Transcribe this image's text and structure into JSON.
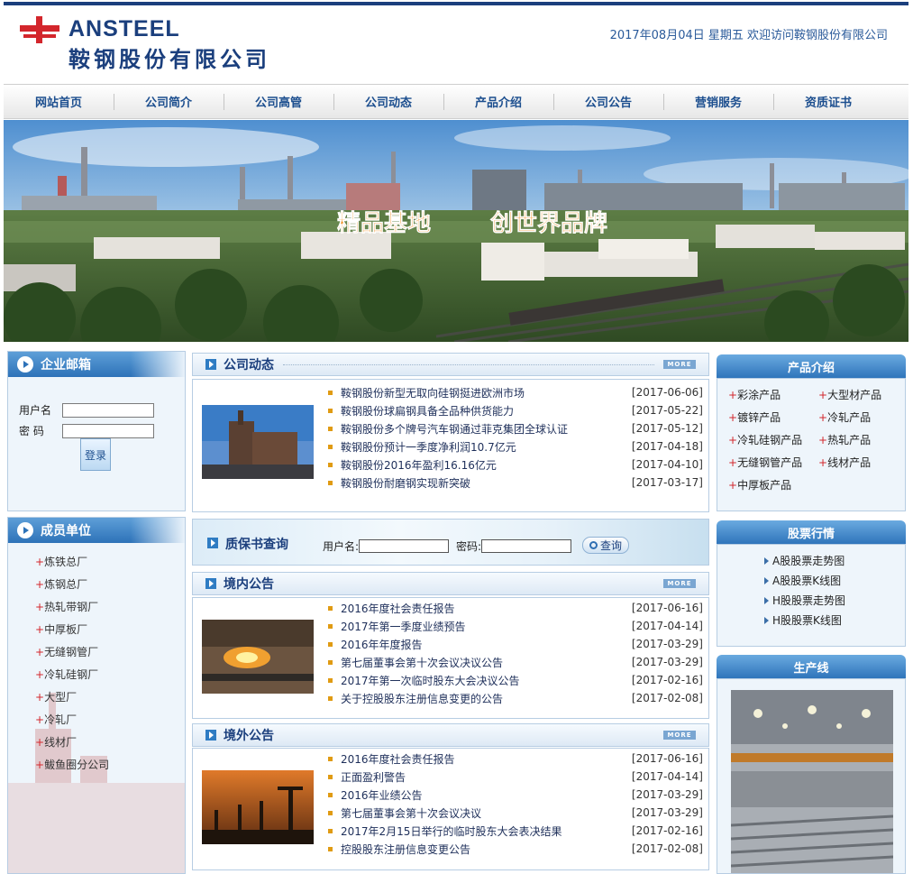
{
  "header": {
    "logo_en": "ANSTEEL",
    "logo_cn": "鞍钢股份有限公司",
    "date_text": "2017年08月04日 星期五 欢迎访问鞍钢股份有限公司",
    "brand_color": "#1b3f7d"
  },
  "nav": [
    "网站首页",
    "公司简介",
    "公司高管",
    "公司动态",
    "产品介绍",
    "公司公告",
    "营销服务",
    "资质证书"
  ],
  "banner": {
    "slogan_part1": "精品基地",
    "slogan_part2": "创世界品牌"
  },
  "mailbox": {
    "title": "企业邮箱",
    "user_label": "用户名",
    "pass_label": "密  码",
    "login_label": "登录"
  },
  "members": {
    "title": "成员单位",
    "items": [
      "炼铁总厂",
      "炼钢总厂",
      "热轧带钢厂",
      "中厚板厂",
      "无缝钢管厂",
      "冷轧硅钢厂",
      "大型厂",
      "冷轧厂",
      "线材厂",
      "鲅鱼圈分公司"
    ]
  },
  "company_news": {
    "title": "公司动态",
    "more": "MORE",
    "items": [
      {
        "title": "鞍钢股份新型无取向硅钢挺进欧洲市场",
        "date": "[2017-06-06]"
      },
      {
        "title": "鞍钢股份球扁钢具备全品种供货能力",
        "date": "[2017-05-22]"
      },
      {
        "title": "鞍钢股份多个牌号汽车钢通过菲克集团全球认证",
        "date": "[2017-05-12]"
      },
      {
        "title": "鞍钢股份预计一季度净利润10.7亿元",
        "date": "[2017-04-18]"
      },
      {
        "title": "鞍钢股份2016年盈利16.16亿元",
        "date": "[2017-04-10]"
      },
      {
        "title": "鞍钢股份耐磨钢实现新突破",
        "date": "[2017-03-17]"
      }
    ]
  },
  "warranty": {
    "title": "质保书查询",
    "user_label": "用户名:",
    "pass_label": "密码:",
    "query_label": "查询"
  },
  "domestic": {
    "title": "境内公告",
    "more": "MORE",
    "items": [
      {
        "title": "2016年度社会责任报告",
        "date": "[2017-06-16]"
      },
      {
        "title": "2017年第一季度业绩预告",
        "date": "[2017-04-14]"
      },
      {
        "title": "2016年年度报告",
        "date": "[2017-03-29]"
      },
      {
        "title": "第七届董事会第十次会议决议公告",
        "date": "[2017-03-29]"
      },
      {
        "title": "2017年第一次临时股东大会决议公告",
        "date": "[2017-02-16]"
      },
      {
        "title": "关于控股股东注册信息变更的公告",
        "date": "[2017-02-08]"
      }
    ]
  },
  "overseas": {
    "title": "境外公告",
    "more": "MORE",
    "items": [
      {
        "title": "2016年度社会责任报告",
        "date": "[2017-06-16]"
      },
      {
        "title": "正面盈利警告",
        "date": "[2017-04-14]"
      },
      {
        "title": "2016年业绩公告",
        "date": "[2017-03-29]"
      },
      {
        "title": "第七届董事会第十次会议决议",
        "date": "[2017-03-29]"
      },
      {
        "title": "2017年2月15日举行的临时股东大会表决结果",
        "date": "[2017-02-16]"
      },
      {
        "title": "控股股东注册信息变更公告",
        "date": "[2017-02-08]"
      }
    ]
  },
  "products": {
    "title": "产品介绍",
    "left": [
      "彩涂产品",
      "镀锌产品",
      "冷轧硅钢产品",
      "无缝钢管产品",
      "中厚板产品"
    ],
    "right": [
      "大型材产品",
      "冷轧产品",
      "热轧产品",
      "线材产品"
    ]
  },
  "stocks": {
    "title": "股票行情",
    "items": [
      "A股股票走势图",
      "A股股票K线图",
      "H股股票走势图",
      "H股股票K线图"
    ]
  },
  "production": {
    "title": "生产线"
  }
}
